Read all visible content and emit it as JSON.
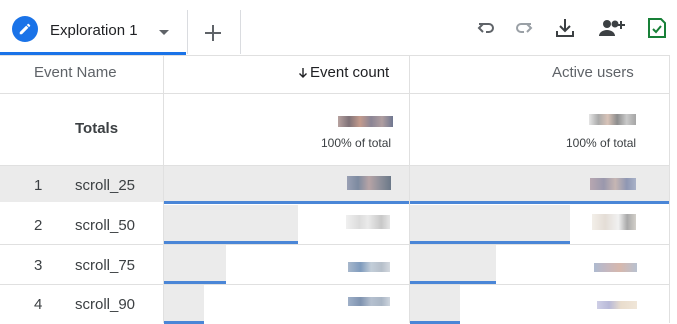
{
  "tab": {
    "title": "Exploration 1"
  },
  "toolbar": {
    "undo_icon": "undo-icon",
    "redo_icon": "redo-icon",
    "download_icon": "download-icon",
    "share_icon": "share-people-icon",
    "save_icon": "check-save-icon"
  },
  "table": {
    "headers": {
      "event_name": "Event Name",
      "event_count": "Event count",
      "active_users": "Active users",
      "sort": "descending"
    },
    "totals": {
      "label": "Totals",
      "event_count_pct": "100% of total",
      "active_users_pct": "100% of total"
    },
    "rows": [
      {
        "index": "1",
        "name": "scroll_25",
        "count_share": 1.0,
        "users_share": 1.0
      },
      {
        "index": "2",
        "name": "scroll_50",
        "count_share": 0.55,
        "users_share": 0.62
      },
      {
        "index": "3",
        "name": "scroll_75",
        "count_share": 0.26,
        "users_share": 0.34
      },
      {
        "index": "4",
        "name": "scroll_90",
        "count_share": 0.16,
        "users_share": 0.2
      }
    ]
  },
  "colors": {
    "accent": "#1a73e8",
    "bar": "#4a86d7",
    "bar_bg": "#ebebeb",
    "save": "#188038"
  }
}
